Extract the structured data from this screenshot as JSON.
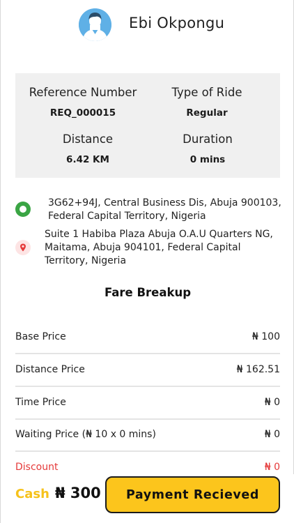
{
  "driver": {
    "name": "Ebi Okpongu",
    "avatar_icon": "user-avatar-icon"
  },
  "ride_info": {
    "reference_label": "Reference Number",
    "reference_value": "REQ_000015",
    "ride_type_label": "Type of Ride",
    "ride_type_value": "Regular",
    "distance_label": "Distance",
    "distance_value": "6.42 KM",
    "duration_label": "Duration",
    "duration_value": "0 mins"
  },
  "locations": {
    "pickup": {
      "icon": "pickup-dot-icon",
      "lines": [
        "3G62+94J, Central Business Dis, Abuja 900103,",
        "Federal Capital Territory, Nigeria"
      ]
    },
    "dropoff": {
      "icon": "map-pin-icon",
      "lines": [
        "Suite 1 Habiba Plaza Abuja O.A.U Quarters NG,",
        "Maitama, Abuja 904101, Federal Capital",
        "Territory, Nigeria"
      ]
    }
  },
  "fare": {
    "title": "Fare Breakup",
    "rows": [
      {
        "label": "Base Price",
        "amount": "₦ 100"
      },
      {
        "label": "Distance Price",
        "amount": "₦ 162.51"
      },
      {
        "label": "Time Price",
        "amount": "₦ 0"
      },
      {
        "label": "Waiting Price (₦ 10 x 0 mins)",
        "amount": "₦ 0"
      },
      {
        "label": "Discount",
        "amount": "₦ 0"
      }
    ]
  },
  "footer": {
    "payment_method": "Cash",
    "total": "₦ 300",
    "button_label": "Payment Recieved"
  },
  "colors": {
    "accent_yellow": "#fcc51c",
    "pickup_green": "#3aa544",
    "discount_red": "#e53a3a",
    "card_gray": "#f0f0f0"
  }
}
